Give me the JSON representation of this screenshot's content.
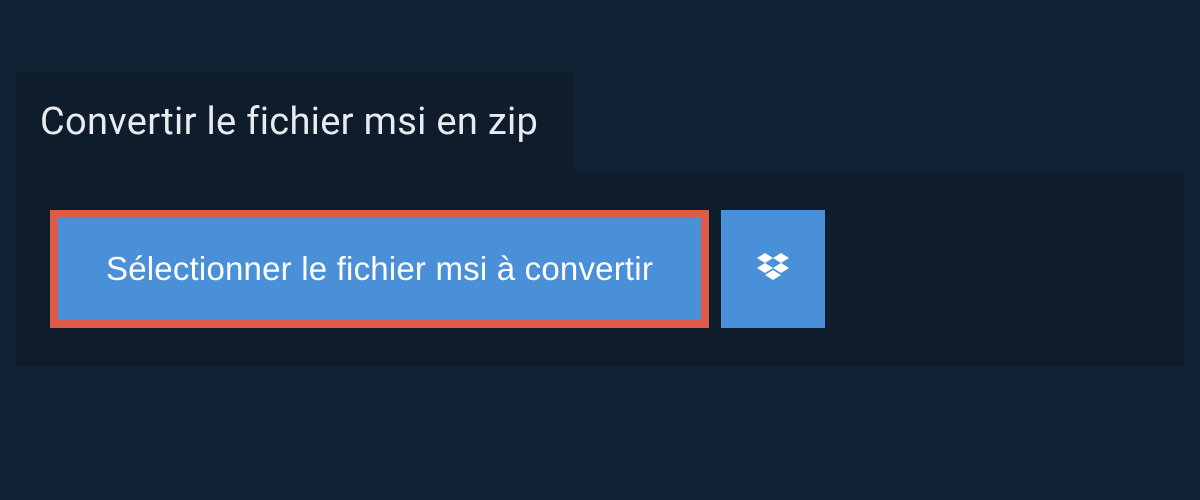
{
  "header": {
    "title": "Convertir le fichier msi en zip"
  },
  "converter": {
    "select_label": "Sélectionner le fichier msi à convertir"
  }
}
